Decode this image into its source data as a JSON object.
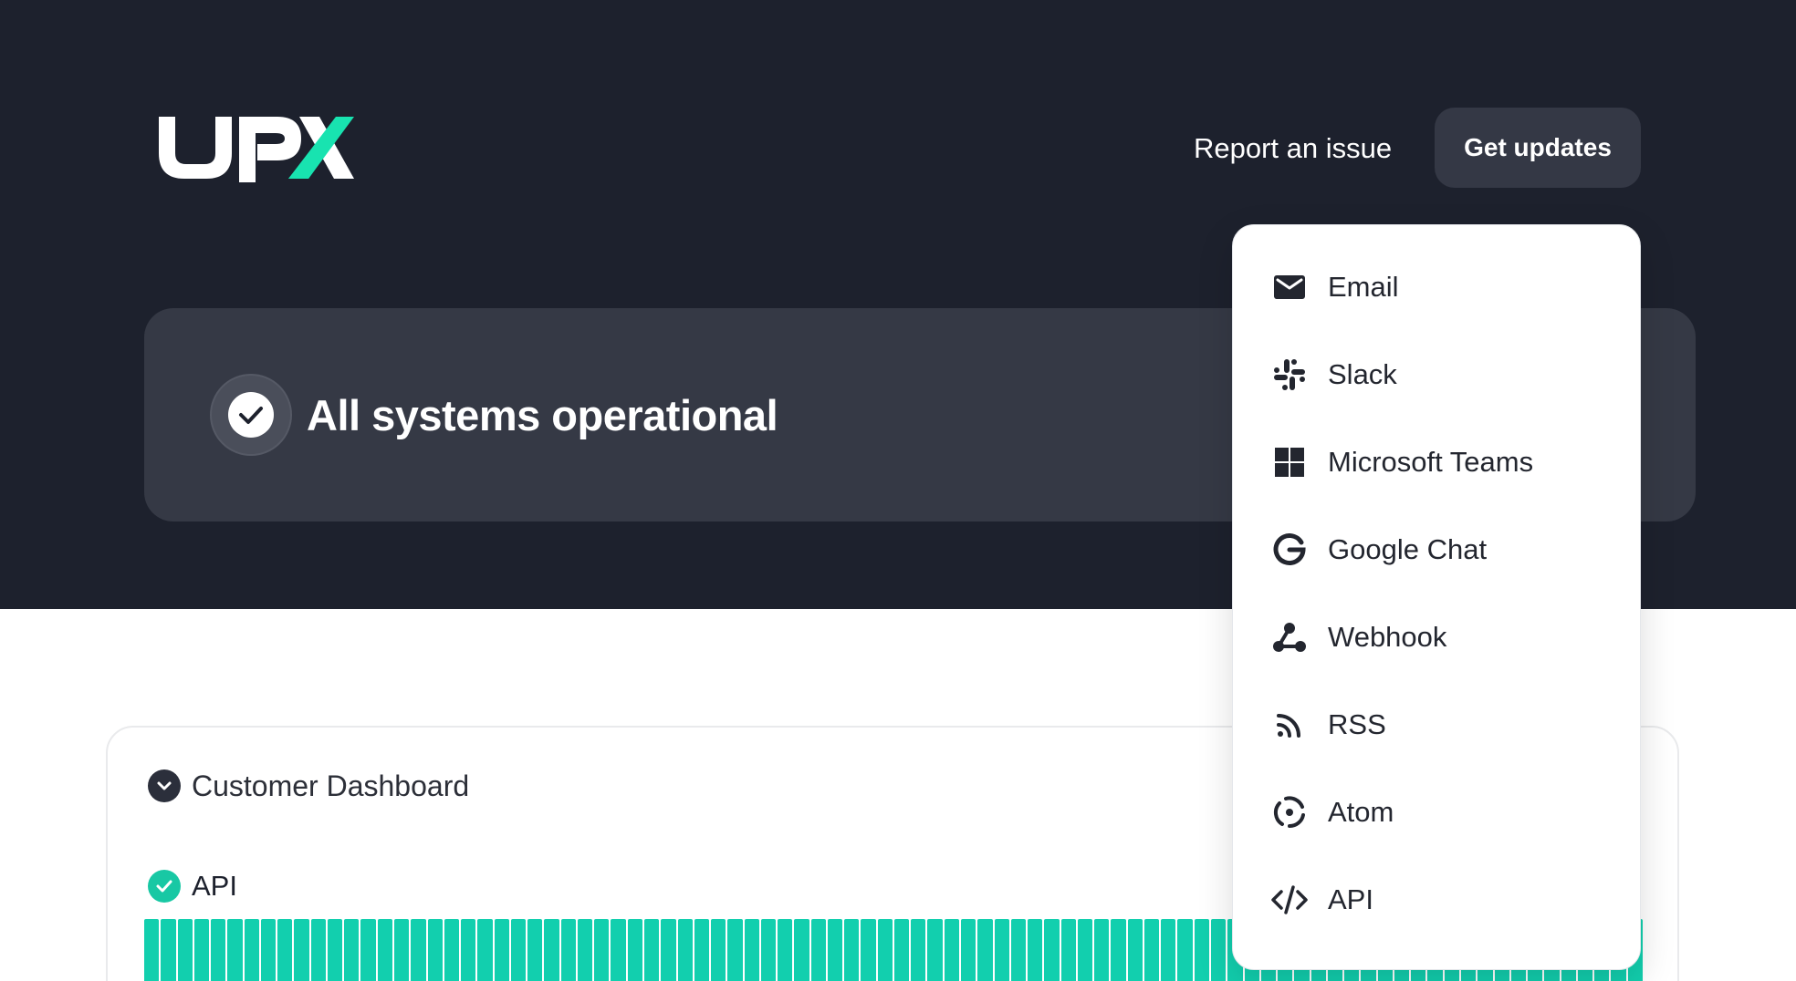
{
  "brand": {
    "logo_text": "UPX",
    "primary_color": "#ffffff",
    "accent_color": "#18e3b0"
  },
  "header": {
    "report_label": "Report an issue",
    "updates_label": "Get updates"
  },
  "status": {
    "text": "All systems operational"
  },
  "group": {
    "title": "Customer Dashboard"
  },
  "component": {
    "title": "API",
    "uptime_bar_color": "#12cfae"
  },
  "subscribe_menu": {
    "items": [
      {
        "label": "Email",
        "icon": "mail-icon"
      },
      {
        "label": "Slack",
        "icon": "slack-icon"
      },
      {
        "label": "Microsoft Teams",
        "icon": "microsoft-teams-icon"
      },
      {
        "label": "Google Chat",
        "icon": "google-icon"
      },
      {
        "label": "Webhook",
        "icon": "webhook-icon"
      },
      {
        "label": "RSS",
        "icon": "rss-icon"
      },
      {
        "label": "Atom",
        "icon": "atom-icon"
      },
      {
        "label": "API",
        "icon": "code-icon"
      }
    ]
  }
}
